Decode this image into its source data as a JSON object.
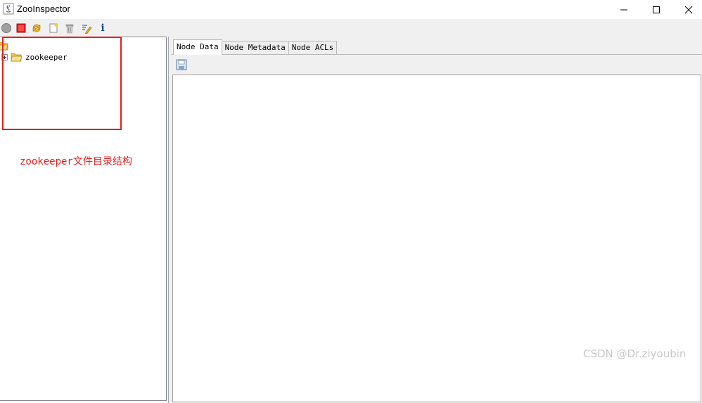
{
  "window": {
    "title": "ZooInspector",
    "controls": [
      "minimize",
      "maximize",
      "close"
    ]
  },
  "toolbar": {
    "buttons": [
      {
        "name": "connect",
        "icon": "connect-icon"
      },
      {
        "name": "disconnect",
        "icon": "stop-icon"
      },
      {
        "name": "refresh",
        "icon": "refresh-icon"
      },
      {
        "name": "add-node",
        "icon": "new-node-icon"
      },
      {
        "name": "delete-node",
        "icon": "trash-icon"
      },
      {
        "name": "node-viewers",
        "icon": "edit-icon"
      },
      {
        "name": "about",
        "icon": "info-icon"
      }
    ],
    "info_glyph": "i"
  },
  "tree": {
    "nodes": [
      {
        "label": "zookeeper",
        "expanded": false
      }
    ]
  },
  "annotation": {
    "text": "zookeeper文件目录结构",
    "color": "#e02020"
  },
  "tabs": [
    {
      "label": "Node Data",
      "active": true
    },
    {
      "label": "Node Metadata",
      "active": false
    },
    {
      "label": "Node ACLs",
      "active": false
    }
  ],
  "editor": {
    "content": ""
  },
  "watermark": {
    "text": "CSDN @Dr.ziyoubin"
  },
  "colors": {
    "accent_red": "#e02020",
    "toolbar_bg": "#f0f0f0",
    "folder_yellow": "#f5c542"
  }
}
